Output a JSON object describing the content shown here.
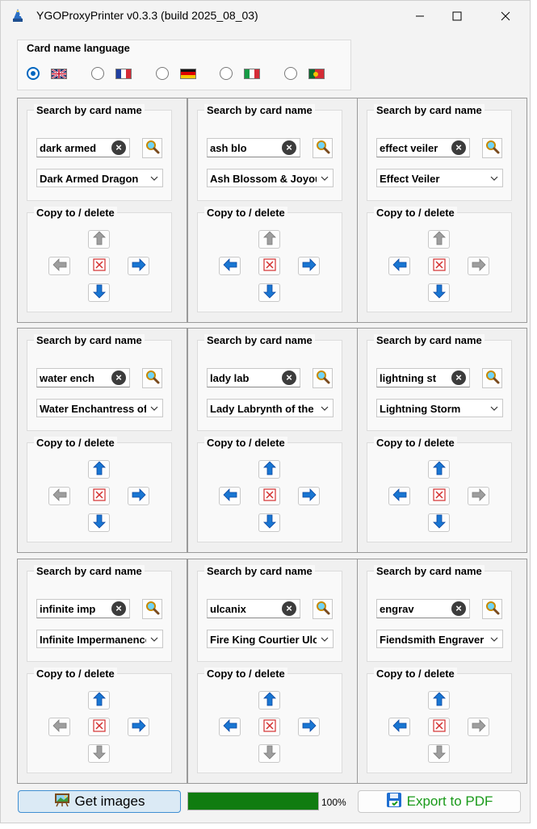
{
  "window": {
    "title": "YGOProxyPrinter v0.3.3 (build 2025_08_03)"
  },
  "language": {
    "legend": "Card name language",
    "options": [
      {
        "icon": "flag-uk-icon",
        "checked": true
      },
      {
        "icon": "flag-france-icon",
        "checked": false
      },
      {
        "icon": "flag-germany-icon",
        "checked": false
      },
      {
        "icon": "flag-italy-icon",
        "checked": false
      },
      {
        "icon": "flag-portugal-icon",
        "checked": false
      }
    ]
  },
  "cells": [
    {
      "search_legend": "Search by card name",
      "query": "dark armed",
      "selected": "Dark Armed Dragon",
      "copy_legend": "Copy to / delete",
      "up": false,
      "left": false,
      "right": true,
      "down": true
    },
    {
      "search_legend": "Search by card name",
      "query": "ash blo",
      "selected": "Ash Blossom & Joyous Spring",
      "copy_legend": "Copy to / delete",
      "up": false,
      "left": true,
      "right": true,
      "down": true
    },
    {
      "search_legend": "Search by card name",
      "query": "effect veiler",
      "selected": "Effect Veiler",
      "copy_legend": "Copy to / delete",
      "up": false,
      "left": true,
      "right": false,
      "down": true
    },
    {
      "search_legend": "Search by card name",
      "query": "water ench",
      "selected": "Water Enchantress of the Temple",
      "copy_legend": "Copy to / delete",
      "up": true,
      "left": false,
      "right": true,
      "down": true
    },
    {
      "search_legend": "Search by card name",
      "query": "lady lab",
      "selected": "Lady Labrynth of the Silver Castle",
      "copy_legend": "Copy to / delete",
      "up": true,
      "left": true,
      "right": true,
      "down": true
    },
    {
      "search_legend": "Search by card name",
      "query": "lightning st",
      "selected": "Lightning Storm",
      "copy_legend": "Copy to / delete",
      "up": true,
      "left": true,
      "right": false,
      "down": true
    },
    {
      "search_legend": "Search by card name",
      "query": "infinite imp",
      "selected": "Infinite Impermanence",
      "copy_legend": "Copy to / delete",
      "up": true,
      "left": false,
      "right": true,
      "down": false
    },
    {
      "search_legend": "Search by card name",
      "query": "ulcanix",
      "selected": "Fire King Courtier Ulcanix",
      "copy_legend": "Copy to / delete",
      "up": true,
      "left": true,
      "right": true,
      "down": false
    },
    {
      "search_legend": "Search by card name",
      "query": "engrav",
      "selected": "Fiendsmith Engraver",
      "copy_legend": "Copy to / delete",
      "up": true,
      "left": true,
      "right": false,
      "down": false
    }
  ],
  "footer": {
    "get_images": "Get images",
    "progress_value": 100,
    "progress_text": "100%",
    "export_pdf": "Export to PDF"
  },
  "colors": {
    "accent": "#0067c0",
    "progress": "#107c10",
    "export_text": "#1a9a1a",
    "arrow_active": "#1976d2",
    "arrow_disabled": "#9e9e9e",
    "delete_red": "#d32f2f"
  }
}
